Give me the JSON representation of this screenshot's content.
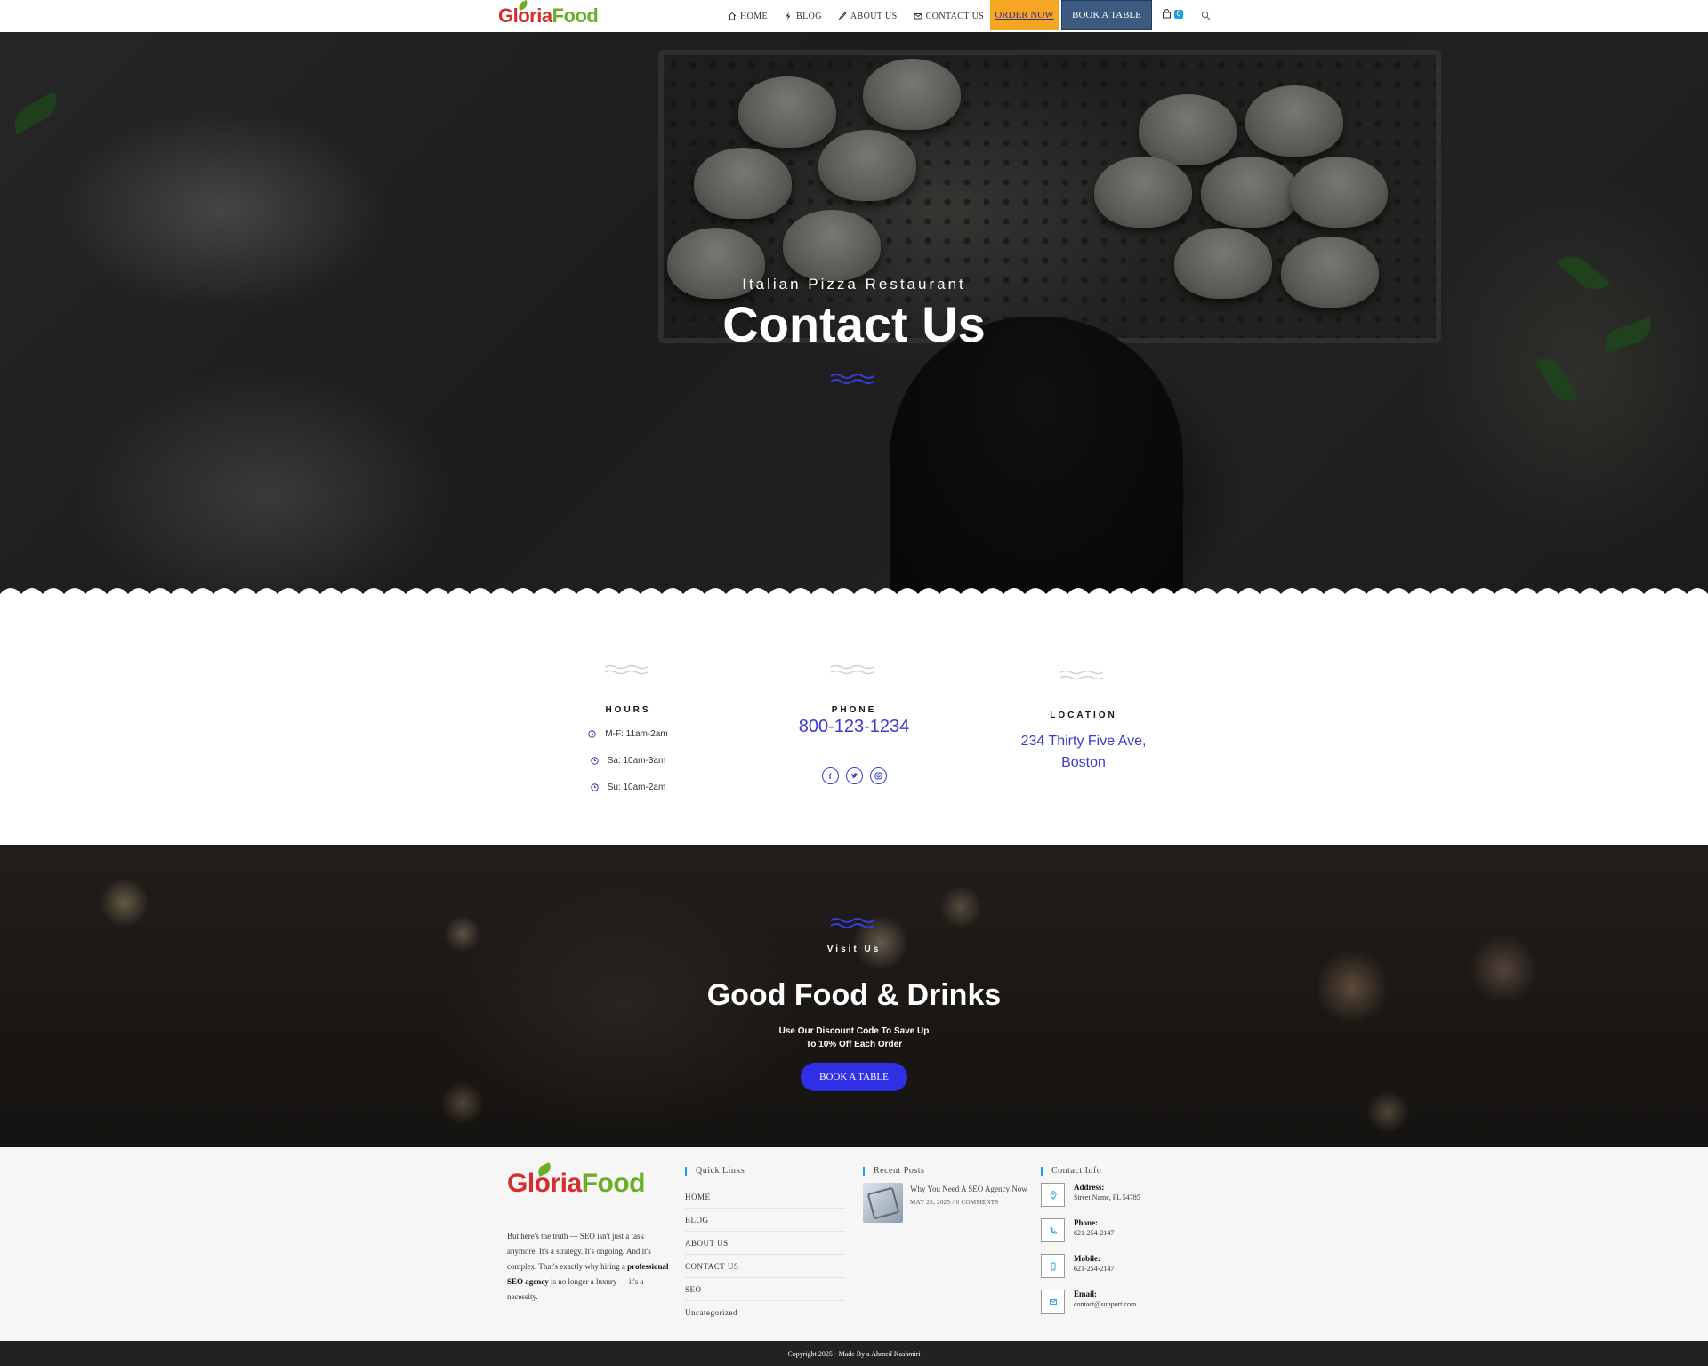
{
  "header": {
    "logo": {
      "part1": "Gloria",
      "part2": "Food"
    },
    "nav": [
      {
        "label": "HOME",
        "icon": "home-icon"
      },
      {
        "label": "BLOG",
        "icon": "bolt-icon"
      },
      {
        "label": "ABOUT US",
        "icon": "rocket-icon"
      },
      {
        "label": "CONTACT US",
        "icon": "envelope-icon"
      }
    ],
    "order_now_label": "ORDER NOW",
    "book_table_label": "BOOK A TABLE",
    "cart_count": "0",
    "search_icon": "search-icon",
    "colors": {
      "order_bg": "#f5a623",
      "book_bg": "#3d5a80",
      "badge": "#1fa1e0"
    }
  },
  "hero": {
    "subtitle": "Italian Pizza Restaurant",
    "title": "Contact Us",
    "accent": "#3a3ad6"
  },
  "info": {
    "hours": {
      "heading": "HOURS",
      "rows": [
        "M-F: 11am-2am",
        "Sa: 10am-3am",
        "Su: 10am-2am"
      ]
    },
    "phone": {
      "heading": "PHONE",
      "number": "800-123-1234",
      "socials": [
        "facebook-icon",
        "twitter-icon",
        "instagram-icon"
      ]
    },
    "location": {
      "heading": "LOCATION",
      "line1": "234 Thirty Five Ave,",
      "line2": "Boston"
    },
    "accent": "#3a3ad6"
  },
  "visit": {
    "tag": "Visit Us",
    "title": "Good Food & Drinks",
    "sub1": "Use Our Discount Code To Save Up",
    "sub2": "To 10% Off Each Order",
    "button": "BOOK A TABLE",
    "button_color": "#2f2fe6"
  },
  "footer": {
    "logo": {
      "part1": "Gloria",
      "part2": "Food"
    },
    "about_pre": "But here's the truth — SEO isn't just a task anymore. It's a strategy. It's ongoing. And it's complex. That's exactly why hiring a",
    "about_bold": "professional SEO agency",
    "about_post": "is no longer a luxury — it's a necessity.",
    "quick_links_title": "Quick Links",
    "quick_links": [
      "HOME",
      "BLOG",
      "ABOUT US",
      "CONTACT US",
      "SEO",
      "Uncategorized"
    ],
    "recent_posts_title": "Recent Posts",
    "post": {
      "title": "Why You Need A SEO Agency Now",
      "date": "MAY 25, 2025",
      "comments": "0 COMMENTS"
    },
    "contact_title": "Contact Info",
    "contact": [
      {
        "label": "Address:",
        "value": "Street Name, FL 54785",
        "icon": "map-pin-icon"
      },
      {
        "label": "Phone:",
        "value": "621-254-2147",
        "icon": "phone-icon"
      },
      {
        "label": "Mobile:",
        "value": "621-254-2147",
        "icon": "mobile-icon"
      },
      {
        "label": "Email:",
        "value": "contact@support.com",
        "icon": "envelope-icon"
      }
    ],
    "title_accent": "#1fa1e0"
  },
  "copyright": "Copyright 2025 - Made By a Ahmed Kashmiri"
}
